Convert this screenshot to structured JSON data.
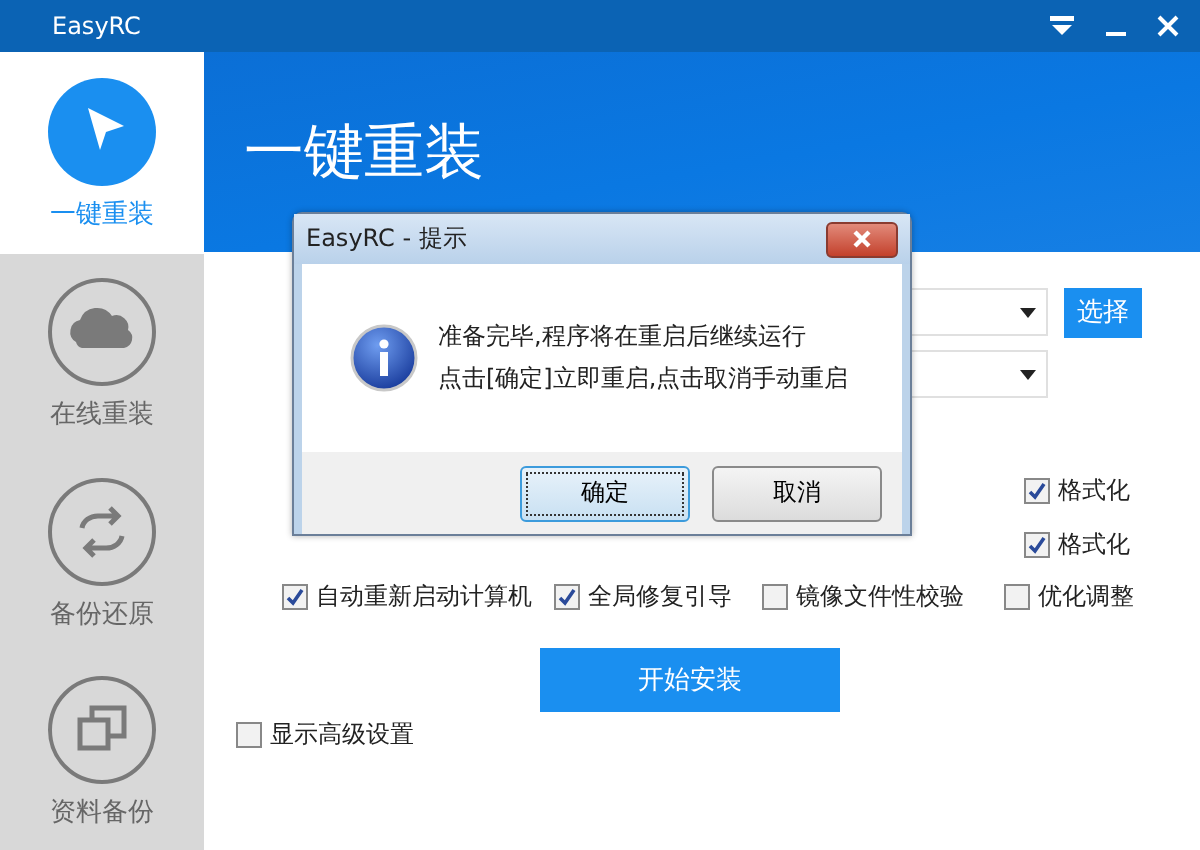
{
  "window": {
    "title": "EasyRC"
  },
  "sidebar": {
    "items": [
      {
        "label": "一键重装",
        "selected": true
      },
      {
        "label": "在线重装",
        "selected": false
      },
      {
        "label": "备份还原",
        "selected": false
      },
      {
        "label": "资料备份",
        "selected": false
      }
    ]
  },
  "header": {
    "title": "一键重装"
  },
  "form": {
    "select_button": "选择",
    "format_options": [
      {
        "label": "格式化",
        "checked": true
      },
      {
        "label": "格式化",
        "checked": true
      }
    ],
    "options": [
      {
        "label": "自动重新启动计算机",
        "checked": true
      },
      {
        "label": "全局修复引导",
        "checked": true
      },
      {
        "label": "镜像文件性校验",
        "checked": false
      },
      {
        "label": "优化调整",
        "checked": false
      }
    ],
    "start_button": "开始安装",
    "advanced": {
      "label": "显示高级设置",
      "checked": false
    }
  },
  "dialog": {
    "title": "EasyRC - 提示",
    "message": [
      "准备完毕,程序将在重启后继续运行",
      "点击[确定]立即重启,点击取消手动重启"
    ],
    "buttons": [
      {
        "label": "确定",
        "selected": true
      },
      {
        "label": "取消",
        "selected": false
      }
    ]
  }
}
